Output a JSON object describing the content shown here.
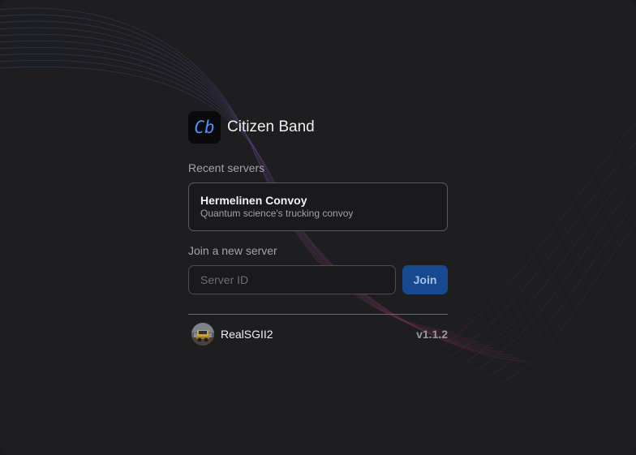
{
  "app": {
    "title": "Citizen Band",
    "logo_text": "Cb",
    "accent_color": "#4f8ff7"
  },
  "recent": {
    "label": "Recent servers",
    "servers": [
      {
        "name": "Hermelinen Convoy",
        "description": "Quantum science's trucking convoy"
      }
    ]
  },
  "join": {
    "label": "Join a new server",
    "input_placeholder": "Server ID",
    "input_value": "",
    "button_label": "Join",
    "button_color": "#16498f"
  },
  "user": {
    "name": "RealSGII2",
    "avatar_icon": "truck-avatar"
  },
  "version": "v1.1.2"
}
